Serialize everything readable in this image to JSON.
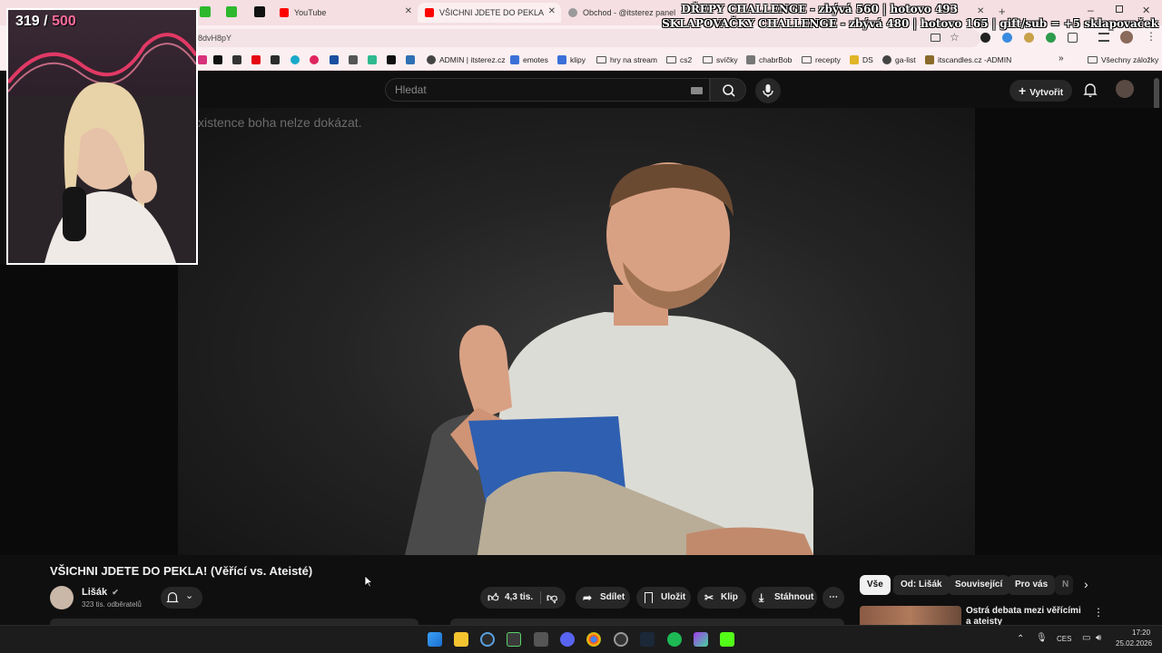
{
  "browser": {
    "tabs": [
      {
        "title": "YouTube",
        "color": "#ff0000"
      },
      {
        "title": "VŠICHNI JDETE DO PEKLA! (Věř",
        "color": "#ff0000"
      },
      {
        "title": "Obchod - @itsterez panel",
        "color": "#9a9a9a"
      }
    ],
    "url": "8dvH8pY",
    "bookmarks": {
      "admin": "ADMIN | itsterez.cz",
      "emotes": "emotes",
      "klipy": "klipy",
      "hry": "hry na stream",
      "cs2": "cs2",
      "svicky": "svíčky",
      "chabrbob": "chabrBob",
      "recepty": "recepty",
      "ds": "DS",
      "galist": "ga-list",
      "itscandles": "itscandles.cz -ADMIN",
      "more": "»",
      "all": "Všechny záložky"
    }
  },
  "overlay": {
    "line1": "DŘEPY CHALLENGE - zbývá 560 | hotovo 493",
    "line2": "SKLAPOVAČKY CHALLENGE - zbývá 480 | hotovo 165 | gift/sub = +5 sklapovaček",
    "counter_current": "319",
    "counter_sep": "/",
    "counter_total": "500"
  },
  "youtube": {
    "search_placeholder": "Hledat",
    "create_label": "Vytvořit",
    "video_caption": "xistence boha nelze dokázat.",
    "video_title": "VŠICHNI JDETE DO PEKLA! (Věřící vs. Ateisté)",
    "channel_name": "Lišák",
    "subscribers": "323 tis. odběratelů",
    "likes": "4,3 tis.",
    "share": "Sdílet",
    "save": "Uložit",
    "clip": "Klip",
    "download": "Stáhnout",
    "chips": [
      "Vše",
      "Od: Lišák",
      "Související",
      "Pro vás",
      "N"
    ],
    "suggested_title": "Ostrá debata mezi věřícími a ateisty"
  },
  "taskbar": {
    "lang": "CES",
    "time": "17:20",
    "date": "25.02.2026"
  }
}
